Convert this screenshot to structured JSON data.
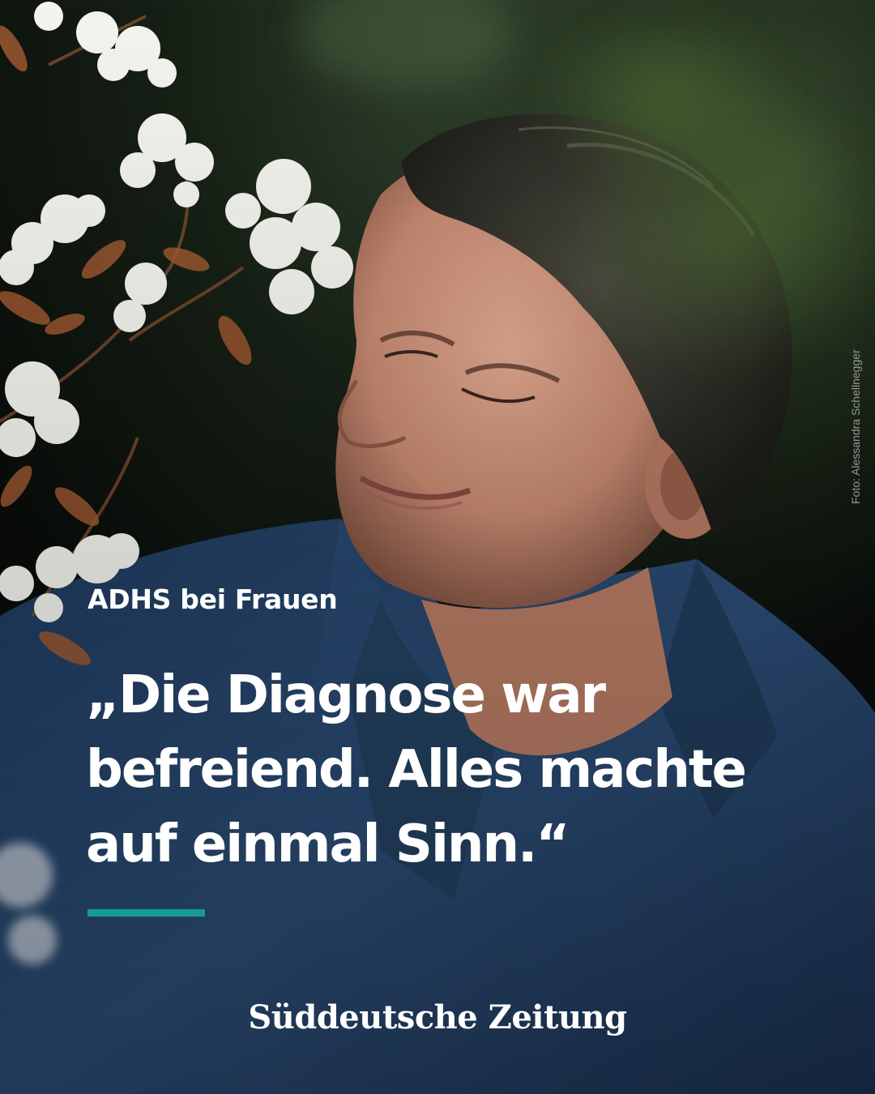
{
  "photo": {
    "subject": "woman-with-blossoms",
    "credit": "Foto: Alessandra Schellnegger"
  },
  "headline": {
    "kicker": "ADHS bei Frauen",
    "quote_lines": [
      "„Die Diagnose war",
      "befreiend. Alles machte",
      "auf einmal Sinn.“"
    ]
  },
  "brand": {
    "name": "Süddeutsche Zeitung"
  },
  "colors": {
    "accent": "#169c93",
    "text": "#ffffff",
    "shirt": "#2a4a70",
    "background": "#0b0f0c"
  }
}
